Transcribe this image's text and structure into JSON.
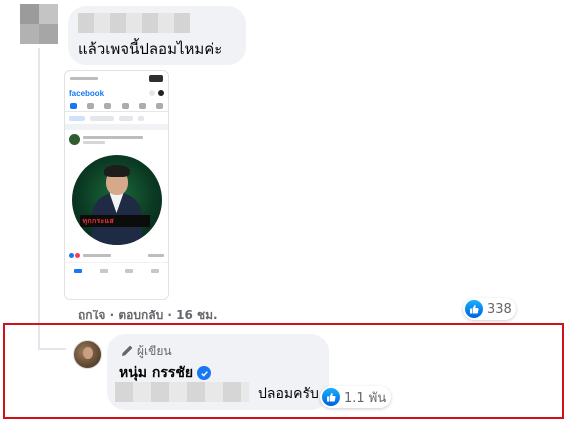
{
  "comment_1": {
    "text": "แล้วเพจนี้ปลอมไหมค่ะ",
    "footer": "ถูกใจ · ตอบกลับ · 16 ชม.",
    "reaction_count": "338"
  },
  "reply": {
    "author_label": "ผู้เขียน",
    "author_name": "หนุ่ม กรรชัย",
    "text": "ปลอมครับ",
    "reaction_count": "1.1 พัน"
  },
  "screenshot_phone": {
    "logo": "facebook",
    "banner": "ทุกกระแส"
  },
  "colors": {
    "like_blue": "#1877f2",
    "highlight_red": "#d2121a",
    "bubble_bg": "#f0f2f5"
  },
  "icons": [
    "pencil-icon",
    "verified-badge-icon",
    "like-reaction-icon"
  ]
}
